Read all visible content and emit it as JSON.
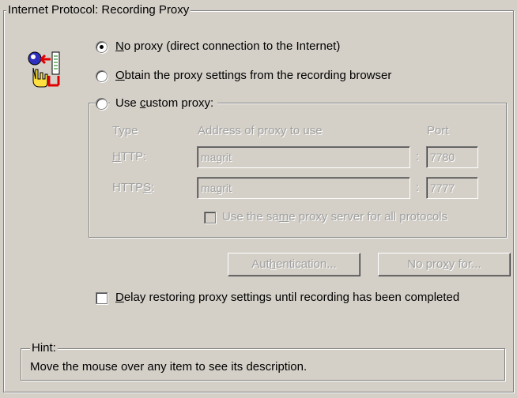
{
  "proxy_group": {
    "title": "Internet Protocol: Recording Proxy",
    "icon": "proxy-settings-icon",
    "options": {
      "no_proxy": {
        "label_pre": "",
        "accel": "N",
        "label_post": "o proxy (direct connection to the Internet)",
        "selected": true
      },
      "obtain_from_browser": {
        "label_pre": "",
        "accel": "O",
        "label_post": "btain the proxy settings from the recording browser",
        "selected": false
      },
      "custom_proxy": {
        "label_pre": "Use ",
        "accel": "c",
        "label_post": "ustom proxy:",
        "selected": false
      }
    },
    "custom": {
      "col_type": "Type",
      "col_address": "Address of proxy to use",
      "col_port": "Port",
      "http": {
        "label_pre": "",
        "accel": "H",
        "label_post": "TTP:",
        "address": "magrit",
        "separator": ":",
        "port": "7780"
      },
      "https": {
        "label_pre": "HTTP",
        "accel": "S",
        "label_post": ":",
        "address": "magrit",
        "separator": ":",
        "port": "7777"
      },
      "same_proxy": {
        "label_pre": "Use the sa",
        "accel": "m",
        "label_post": "e proxy server for all protocols",
        "checked": false,
        "enabled": false
      }
    },
    "buttons": {
      "authentication": {
        "label_pre": "Aut",
        "accel": "h",
        "label_post": "entication...",
        "enabled": false
      },
      "no_proxy_for": {
        "label_pre": "No pro",
        "accel": "x",
        "label_post": "y for...",
        "enabled": false
      }
    },
    "delay_restore": {
      "label_pre": "",
      "accel": "D",
      "label_post": "elay restoring proxy settings until recording has been completed",
      "checked": false
    }
  },
  "hint": {
    "title": "Hint:",
    "text": "Move the mouse over any item to see its description."
  }
}
